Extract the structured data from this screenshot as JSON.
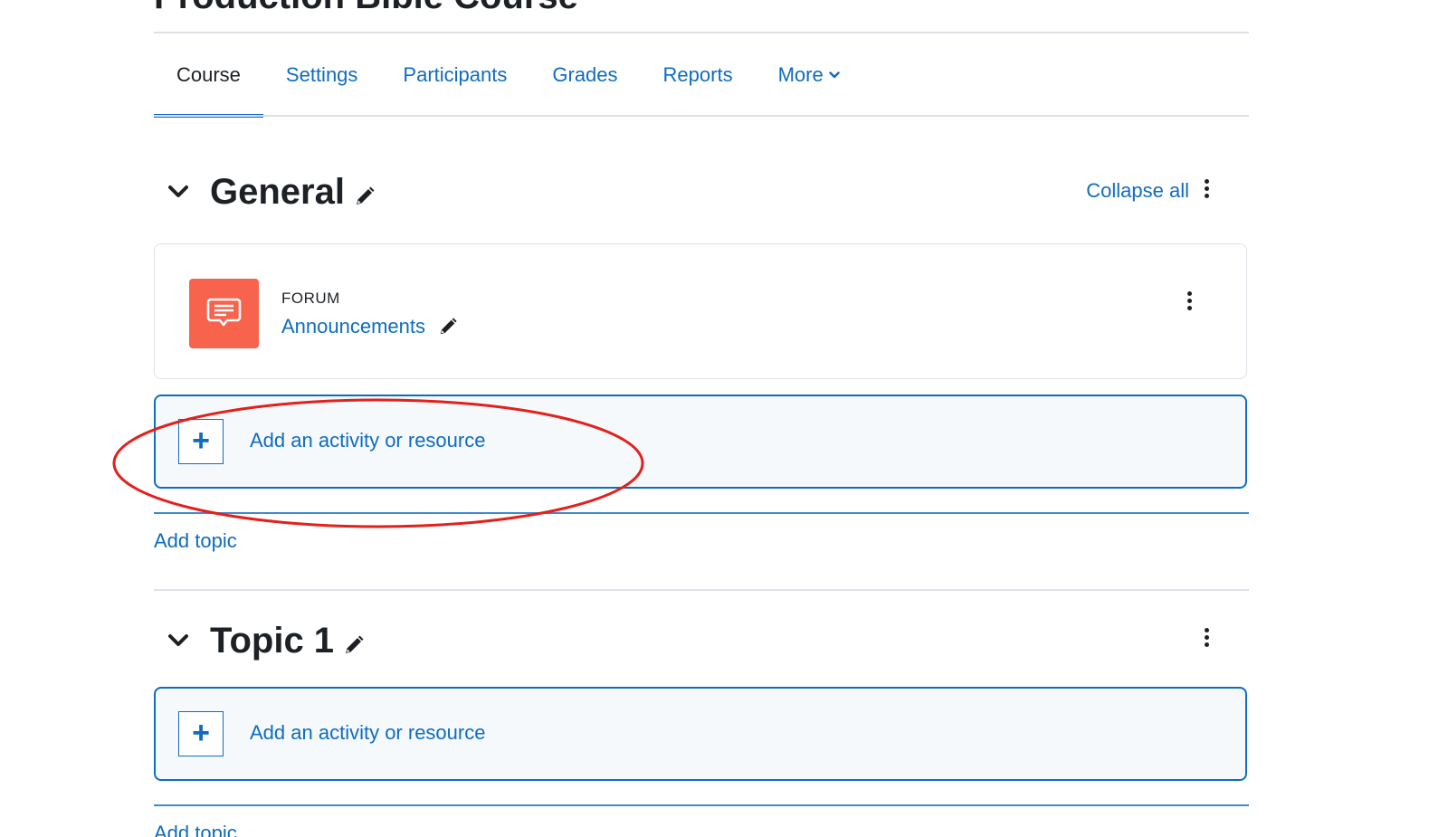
{
  "course": {
    "title": "Production Bible Course"
  },
  "nav": {
    "tabs": [
      {
        "label": "Course",
        "active": true
      },
      {
        "label": "Settings",
        "active": false
      },
      {
        "label": "Participants",
        "active": false
      },
      {
        "label": "Grades",
        "active": false
      },
      {
        "label": "Reports",
        "active": false
      },
      {
        "label": "More",
        "active": false
      }
    ]
  },
  "sections": [
    {
      "title": "General",
      "collapse_all_label": "Collapse all",
      "activities": [
        {
          "type": "FORUM",
          "name": "Announcements",
          "icon": "forum-icon",
          "icon_color": "#f7634d"
        }
      ],
      "add_activity_label": "Add an activity or resource",
      "add_topic_label": "Add topic"
    },
    {
      "title": "Topic 1",
      "add_activity_label": "Add an activity or resource",
      "add_topic_label": "Add topic"
    }
  ],
  "colors": {
    "link": "#0f6cbf",
    "text": "#1d2125",
    "annotation": "#e3201b"
  }
}
